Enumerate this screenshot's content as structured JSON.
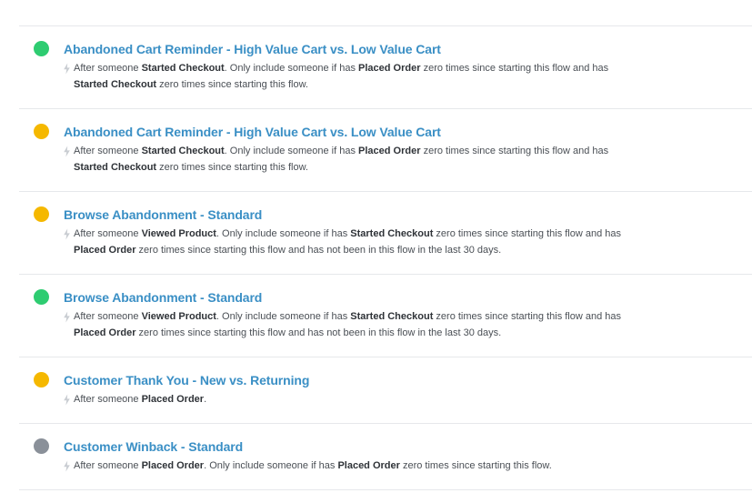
{
  "colors": {
    "active": "#2ecc71",
    "manual": "#f5b800",
    "draft": "#8a9099",
    "title": "#3a8fc5"
  },
  "flows": [
    {
      "status": "active",
      "title": "Abandoned Cart Reminder - High Value Cart vs. Low Value Cart",
      "trigger_icon": "lightning-icon",
      "trigger": [
        {
          "t": "After someone "
        },
        {
          "t": "Started Checkout",
          "b": true
        },
        {
          "t": ". Only include someone if has "
        },
        {
          "t": "Placed Order",
          "b": true
        },
        {
          "t": " zero times since starting this flow and has "
        },
        {
          "t": "Started Checkout",
          "b": true
        },
        {
          "t": " zero times since starting this flow."
        }
      ]
    },
    {
      "status": "manual",
      "title": "Abandoned Cart Reminder - High Value Cart vs. Low Value Cart",
      "trigger_icon": "lightning-icon",
      "trigger": [
        {
          "t": "After someone "
        },
        {
          "t": "Started Checkout",
          "b": true
        },
        {
          "t": ". Only include someone if has "
        },
        {
          "t": "Placed Order",
          "b": true
        },
        {
          "t": " zero times since starting this flow and has "
        },
        {
          "t": "Started Checkout",
          "b": true
        },
        {
          "t": " zero times since starting this flow."
        }
      ]
    },
    {
      "status": "manual",
      "title": "Browse Abandonment - Standard",
      "trigger_icon": "lightning-icon",
      "trigger": [
        {
          "t": "After someone "
        },
        {
          "t": "Viewed Product",
          "b": true
        },
        {
          "t": ". Only include someone if has "
        },
        {
          "t": "Started Checkout",
          "b": true
        },
        {
          "t": " zero times since starting this flow and has "
        },
        {
          "t": "Placed Order",
          "b": true
        },
        {
          "t": " zero times since starting this flow and has not been in this flow in the last 30 days."
        }
      ]
    },
    {
      "status": "active",
      "title": "Browse Abandonment - Standard",
      "trigger_icon": "lightning-icon",
      "trigger": [
        {
          "t": "After someone "
        },
        {
          "t": "Viewed Product",
          "b": true
        },
        {
          "t": ". Only include someone if has "
        },
        {
          "t": "Started Checkout",
          "b": true
        },
        {
          "t": " zero times since starting this flow and has "
        },
        {
          "t": "Placed Order",
          "b": true
        },
        {
          "t": " zero times since starting this flow and has not been in this flow in the last 30 days."
        }
      ]
    },
    {
      "status": "manual",
      "title": "Customer Thank You - New vs. Returning",
      "trigger_icon": "lightning-icon",
      "trigger": [
        {
          "t": "After someone "
        },
        {
          "t": "Placed Order",
          "b": true
        },
        {
          "t": "."
        }
      ]
    },
    {
      "status": "draft",
      "title": "Customer Winback - Standard",
      "trigger_icon": "lightning-icon",
      "trigger": [
        {
          "t": "After someone "
        },
        {
          "t": "Placed Order",
          "b": true
        },
        {
          "t": ". Only include someone if has "
        },
        {
          "t": "Placed Order",
          "b": true
        },
        {
          "t": " zero times since starting this flow."
        }
      ]
    }
  ]
}
